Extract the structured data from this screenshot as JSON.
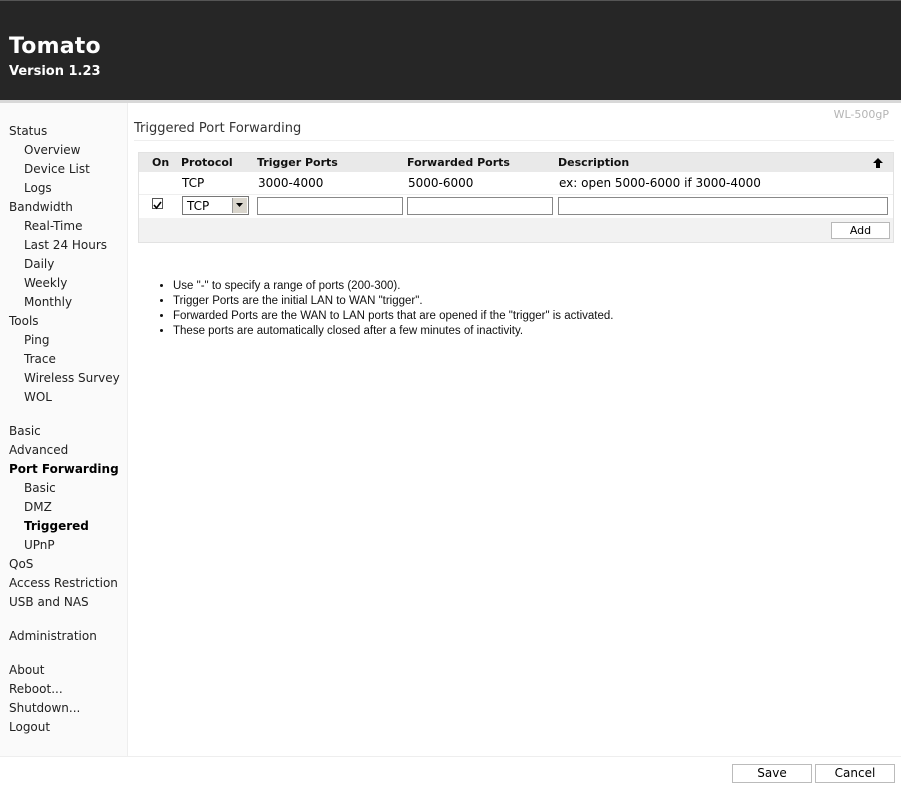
{
  "header": {
    "title": "Tomato",
    "version": "Version 1.23"
  },
  "model": "WL-500gP",
  "page_title": "Triggered Port Forwarding",
  "nav": {
    "status": "Status",
    "overview": "Overview",
    "device_list": "Device List",
    "logs": "Logs",
    "bandwidth": "Bandwidth",
    "real_time": "Real-Time",
    "last_24_hours": "Last 24 Hours",
    "daily": "Daily",
    "weekly": "Weekly",
    "monthly": "Monthly",
    "tools": "Tools",
    "ping": "Ping",
    "trace": "Trace",
    "wireless_survey": "Wireless Survey",
    "wol": "WOL",
    "basic": "Basic",
    "advanced": "Advanced",
    "port_forwarding": "Port Forwarding",
    "pf_basic": "Basic",
    "pf_dmz": "DMZ",
    "pf_triggered": "Triggered",
    "pf_upnp": "UPnP",
    "qos": "QoS",
    "access_restriction": "Access Restriction",
    "usb_nas": "USB and NAS",
    "administration": "Administration",
    "about": "About",
    "reboot": "Reboot...",
    "shutdown": "Shutdown...",
    "logout": "Logout"
  },
  "grid": {
    "columns": {
      "on": "On",
      "protocol": "Protocol",
      "trigger_ports": "Trigger Ports",
      "forwarded_ports": "Forwarded Ports",
      "description": "Description"
    },
    "sort_icon": "up-arrow-icon",
    "rows": [
      {
        "protocol": "TCP",
        "trigger_ports": "3000-4000",
        "forwarded_ports": "5000-6000",
        "description": "ex: open 5000-6000 if 3000-4000"
      }
    ],
    "edit_row": {
      "on_checked": true,
      "protocol_value": "TCP",
      "trigger_ports": "",
      "forwarded_ports": "",
      "description": ""
    },
    "add_label": "Add"
  },
  "notes": [
    "Use \"-\" to specify a range of ports (200-300).",
    "Trigger Ports are the initial LAN to WAN \"trigger\".",
    "Forwarded Ports are the WAN to LAN ports that are opened if the \"trigger\" is activated.",
    "These ports are automatically closed after a few minutes of inactivity."
  ],
  "footer": {
    "save_label": "Save",
    "cancel_label": "Cancel"
  },
  "colors": {
    "header_bg": "#262626",
    "sidebar_bg": "#fafafa",
    "grid_header_bg": "#e9e9e9"
  }
}
